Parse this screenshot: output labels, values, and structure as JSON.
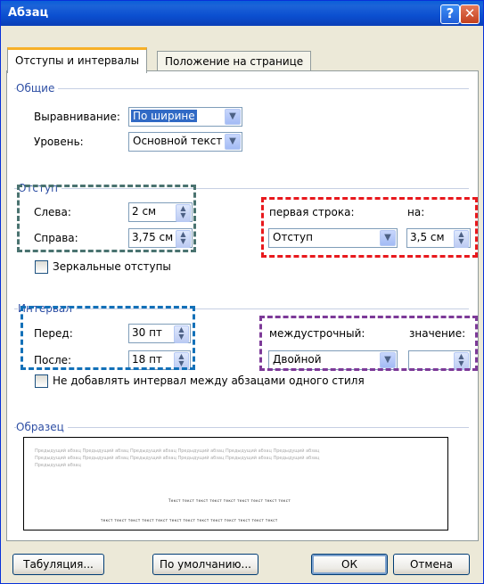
{
  "window": {
    "title": "Абзац",
    "help_label": "?",
    "close_label": "✕"
  },
  "tabs": [
    {
      "label": "Отступы и интервалы"
    },
    {
      "label": "Положение на странице"
    }
  ],
  "general": {
    "section_label": "Общие",
    "alignment_label": "Выравнивание:",
    "alignment_value": "По ширине",
    "level_label": "Уровень:",
    "level_value": "Основной текст"
  },
  "indent": {
    "section_label": "Отступ",
    "left_label": "Слева:",
    "left_value": "2 см",
    "right_label": "Справа:",
    "right_value": "3,75 см",
    "first_line_label": "первая строка:",
    "first_line_value": "Отступ",
    "by_label": "на:",
    "by_value": "3,5 см",
    "mirror_label": "Зеркальные отступы"
  },
  "spacing": {
    "section_label": "Интервал",
    "before_label": "Перед:",
    "before_value": "30 пт",
    "after_label": "После:",
    "after_value": "18 пт",
    "line_label": "междустрочный:",
    "line_value": "Двойной",
    "value_label": "значение:",
    "value_value": "",
    "dont_add_label": "Не добавлять интервал между абзацами одного стиля"
  },
  "preview": {
    "section_label": "Образец",
    "prev_lines": [
      "Предыдущий абзац Предыдущий абзац Предыдущий абзац Предыдущий абзац Предыдущий абзац Предыдущий абзац",
      "Предыдущий абзац Предыдущий абзац Предыдущий абзац Предыдущий абзац Предыдущий абзац Предыдущий абзац",
      "Предыдущий абзац"
    ],
    "text_line1": "Текст текст текст текст текст текст текст текст текст",
    "text_line2": "текст текст текст текст текст текст текст текст текст текст текст текст текст"
  },
  "buttons": {
    "tabs_label": "Табуляция...",
    "default_label": "По умолчанию...",
    "ok_label": "ОК",
    "cancel_label": "Отмена"
  },
  "colors": {
    "gray_box": "#4a7370",
    "red_box": "#e8191d",
    "blue_box": "#1270b8",
    "purple_box": "#7d3a98"
  }
}
